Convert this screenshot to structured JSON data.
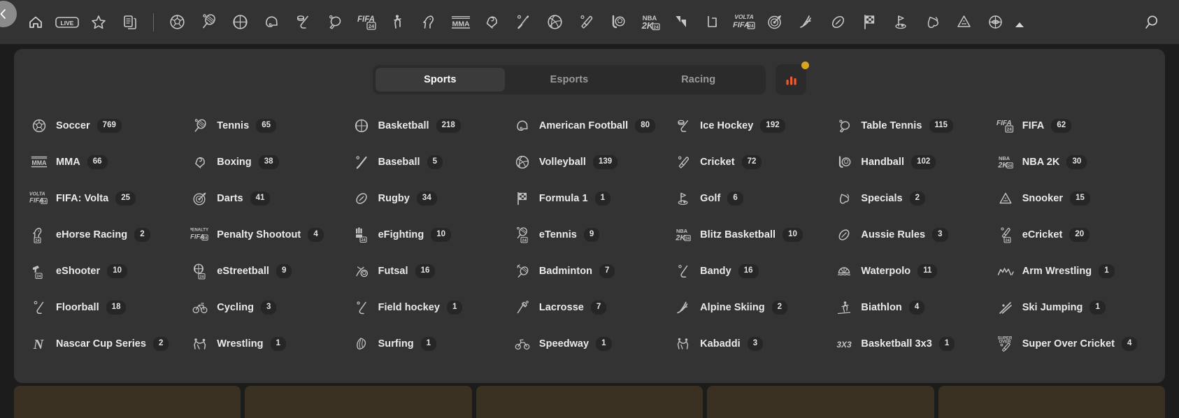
{
  "topnav": {
    "back_label": "back-chevron",
    "items": [
      {
        "name": "home",
        "icon": "home-icon",
        "label": "Home"
      },
      {
        "name": "live",
        "icon": "live-icon",
        "label": "LIVE"
      },
      {
        "name": "favourites",
        "icon": "star-icon",
        "label": "Favourites"
      },
      {
        "name": "betslip",
        "icon": "documents-icon",
        "label": "My Bets"
      },
      {
        "name": "divider",
        "icon": "divider",
        "label": ""
      },
      {
        "name": "soccer",
        "icon": "soccer-ball-icon",
        "label": "Soccer"
      },
      {
        "name": "tennis",
        "icon": "tennis-racket-icon",
        "label": "Tennis"
      },
      {
        "name": "basketball",
        "icon": "basketball-icon",
        "label": "Basketball"
      },
      {
        "name": "american-football",
        "icon": "football-helmet-icon",
        "label": "American Football"
      },
      {
        "name": "ice-hockey",
        "icon": "hockey-stick-icon",
        "label": "Ice Hockey"
      },
      {
        "name": "table-tennis",
        "icon": "paddle-icon",
        "label": "Table Tennis"
      },
      {
        "name": "fifa",
        "icon": "fifa-24-icon",
        "label": "FIFA"
      },
      {
        "name": "cricket-player",
        "icon": "batsman-icon",
        "label": "Cricket"
      },
      {
        "name": "horse-racing",
        "icon": "horse-icon",
        "label": "Horse Racing"
      },
      {
        "name": "mma",
        "icon": "mma-icon",
        "label": "MMA"
      },
      {
        "name": "boxing",
        "icon": "boxing-glove-icon",
        "label": "Boxing"
      },
      {
        "name": "baseball",
        "icon": "baseball-bat-icon",
        "label": "Baseball"
      },
      {
        "name": "volleyball",
        "icon": "volleyball-icon",
        "label": "Volleyball"
      },
      {
        "name": "cricket",
        "icon": "cricket-bat-icon",
        "label": "Cricket"
      },
      {
        "name": "handball",
        "icon": "handball-icon",
        "label": "Handball"
      },
      {
        "name": "nba2k",
        "icon": "nba-2k-icon",
        "label": "NBA 2K"
      },
      {
        "name": "esports",
        "icon": "esports-slash-icon",
        "label": "Esports"
      },
      {
        "name": "lol",
        "icon": "league-icon",
        "label": "League of Legends"
      },
      {
        "name": "volta-fifa",
        "icon": "volta-fifa-icon",
        "label": "FIFA: Volta"
      },
      {
        "name": "darts",
        "icon": "dartboard-icon",
        "label": "Darts"
      },
      {
        "name": "skiing",
        "icon": "skier-icon",
        "label": "Alpine Skiing"
      },
      {
        "name": "rugby",
        "icon": "rugby-ball-icon",
        "label": "Rugby"
      },
      {
        "name": "formula1",
        "icon": "checkered-flag-icon",
        "label": "Formula 1"
      },
      {
        "name": "golf",
        "icon": "golf-flag-icon",
        "label": "Golf"
      },
      {
        "name": "specials",
        "icon": "specials-icon",
        "label": "Specials"
      },
      {
        "name": "snooker",
        "icon": "snooker-rack-icon",
        "label": "Snooker"
      },
      {
        "name": "eshooter",
        "icon": "target-eye-icon",
        "label": "eShooter"
      }
    ],
    "caret": "chevron-up-icon",
    "search": "search-icon"
  },
  "tabs": {
    "items": [
      {
        "label": "Sports",
        "active": true
      },
      {
        "label": "Esports",
        "active": false
      },
      {
        "label": "Racing",
        "active": false
      }
    ],
    "stats_button": {
      "icon": "bar-chart-icon",
      "badge": true,
      "badge_color": "#d9a520",
      "icon_color": "#f05a33"
    }
  },
  "sports": [
    {
      "label": "Soccer",
      "count": "769",
      "icon": "soccer-ball-icon"
    },
    {
      "label": "Tennis",
      "count": "65",
      "icon": "tennis-racket-icon"
    },
    {
      "label": "Basketball",
      "count": "218",
      "icon": "basketball-icon"
    },
    {
      "label": "American Football",
      "count": "80",
      "icon": "football-helmet-icon"
    },
    {
      "label": "Ice Hockey",
      "count": "192",
      "icon": "hockey-stick-icon"
    },
    {
      "label": "Table Tennis",
      "count": "115",
      "icon": "paddle-icon"
    },
    {
      "label": "FIFA",
      "count": "62",
      "icon": "fifa-24-icon"
    },
    {
      "label": "MMA",
      "count": "66",
      "icon": "mma-icon"
    },
    {
      "label": "Boxing",
      "count": "38",
      "icon": "boxing-glove-icon"
    },
    {
      "label": "Baseball",
      "count": "5",
      "icon": "baseball-bat-icon"
    },
    {
      "label": "Volleyball",
      "count": "139",
      "icon": "volleyball-icon"
    },
    {
      "label": "Cricket",
      "count": "72",
      "icon": "cricket-bat-icon"
    },
    {
      "label": "Handball",
      "count": "102",
      "icon": "handball-icon"
    },
    {
      "label": "NBA 2K",
      "count": "30",
      "icon": "nba-2k-icon"
    },
    {
      "label": "FIFA: Volta",
      "count": "25",
      "icon": "volta-fifa-icon"
    },
    {
      "label": "Darts",
      "count": "41",
      "icon": "dartboard-icon"
    },
    {
      "label": "Rugby",
      "count": "34",
      "icon": "rugby-ball-icon"
    },
    {
      "label": "Formula 1",
      "count": "1",
      "icon": "checkered-flag-icon"
    },
    {
      "label": "Golf",
      "count": "6",
      "icon": "golf-flag-icon"
    },
    {
      "label": "Specials",
      "count": "2",
      "icon": "specials-icon"
    },
    {
      "label": "Snooker",
      "count": "15",
      "icon": "snooker-rack-icon"
    },
    {
      "label": "eHorse Racing",
      "count": "2",
      "icon": "ehorse-24-icon"
    },
    {
      "label": "Penalty Shootout",
      "count": "4",
      "icon": "penalty-fifa-icon"
    },
    {
      "label": "eFighting",
      "count": "10",
      "icon": "efighting-24-icon"
    },
    {
      "label": "eTennis",
      "count": "9",
      "icon": "etennis-24-icon"
    },
    {
      "label": "Blitz Basketball",
      "count": "10",
      "icon": "nba-2k-icon"
    },
    {
      "label": "Aussie Rules",
      "count": "3",
      "icon": "aussie-ball-icon"
    },
    {
      "label": "eCricket",
      "count": "20",
      "icon": "ecricket-24-icon"
    },
    {
      "label": "eShooter",
      "count": "10",
      "icon": "eshooter-24-icon"
    },
    {
      "label": "eStreetball",
      "count": "9",
      "icon": "estreetball-24-icon"
    },
    {
      "label": "Futsal",
      "count": "16",
      "icon": "futsal-icon"
    },
    {
      "label": "Badminton",
      "count": "7",
      "icon": "badminton-icon"
    },
    {
      "label": "Bandy",
      "count": "16",
      "icon": "bandy-stick-icon"
    },
    {
      "label": "Waterpolo",
      "count": "11",
      "icon": "waterpolo-icon"
    },
    {
      "label": "Arm Wrestling",
      "count": "1",
      "icon": "arm-wrestling-icon"
    },
    {
      "label": "Floorball",
      "count": "18",
      "icon": "floorball-icon"
    },
    {
      "label": "Cycling",
      "count": "3",
      "icon": "bicycle-icon"
    },
    {
      "label": "Field hockey",
      "count": "1",
      "icon": "field-hockey-icon"
    },
    {
      "label": "Lacrosse",
      "count": "7",
      "icon": "lacrosse-icon"
    },
    {
      "label": "Alpine Skiing",
      "count": "2",
      "icon": "skier-icon"
    },
    {
      "label": "Biathlon",
      "count": "4",
      "icon": "biathlon-icon"
    },
    {
      "label": "Ski Jumping",
      "count": "1",
      "icon": "ski-jumper-icon"
    },
    {
      "label": "Nascar Cup Series",
      "count": "2",
      "icon": "nascar-n-icon"
    },
    {
      "label": "Wrestling",
      "count": "1",
      "icon": "wrestling-icon"
    },
    {
      "label": "Surfing",
      "count": "1",
      "icon": "surfing-icon"
    },
    {
      "label": "Speedway",
      "count": "1",
      "icon": "speedway-icon"
    },
    {
      "label": "Kabaddi",
      "count": "3",
      "icon": "kabaddi-icon"
    },
    {
      "label": "Basketball 3x3",
      "count": "1",
      "icon": "three-x-three-icon"
    },
    {
      "label": "Super Over Cricket",
      "count": "4",
      "icon": "super-over-icon"
    }
  ],
  "colors": {
    "background": "#1c1c1c",
    "panel": "#333333",
    "topnav": "#333333",
    "tab_active": "#3b3b3b",
    "text": "#eaeaea",
    "muted": "#9a9a9a",
    "icon": "#c2c2c2",
    "badge_bg": "#262626",
    "accent_orange": "#f05a33",
    "accent_gold": "#d9a520"
  }
}
